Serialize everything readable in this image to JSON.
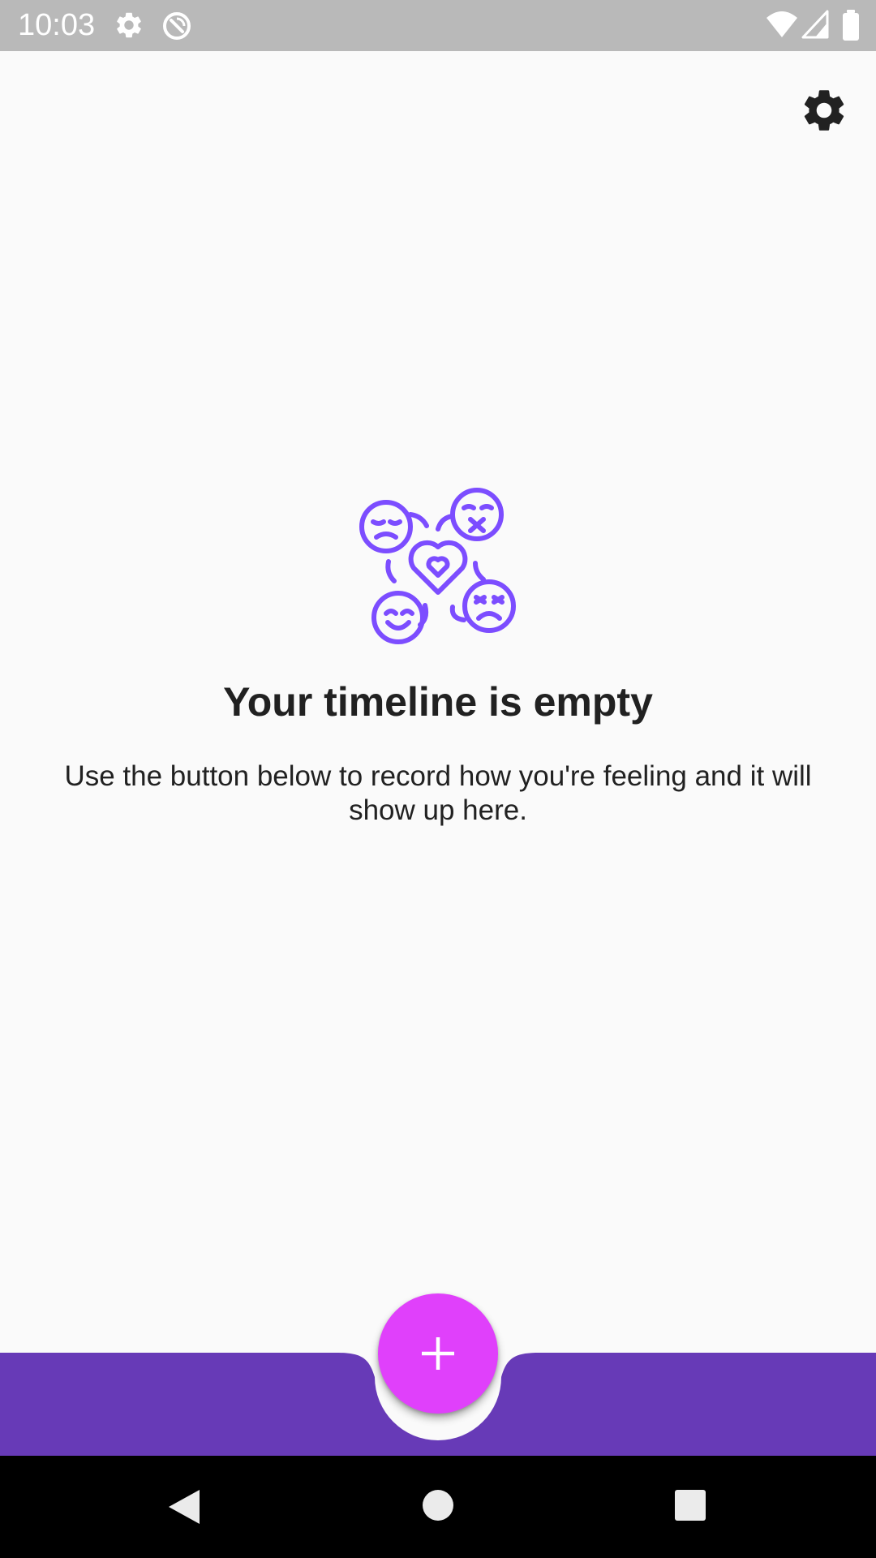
{
  "status_bar": {
    "time": "10:03",
    "icons": [
      "gear-icon",
      "no-sync-icon",
      "wifi-icon",
      "cell-signal-icon",
      "battery-icon"
    ]
  },
  "toolbar": {
    "settings_icon": "settings-gear-icon"
  },
  "empty_state": {
    "illustration": "emotions-cluster-icon",
    "title": "Your timeline is empty",
    "description": "Use the button below to record how you're feeling and it will show up here."
  },
  "bottom_bar": {
    "fab_icon": "plus-icon"
  },
  "nav_bar": {
    "buttons": [
      "back-icon",
      "home-icon",
      "recents-icon"
    ]
  },
  "colors": {
    "status_bar": "#b9b9b9",
    "background": "#fafafa",
    "accent": "#7c4dff",
    "bottom_bar": "#673ab7",
    "fab": "#e040fb",
    "text": "#212121"
  }
}
